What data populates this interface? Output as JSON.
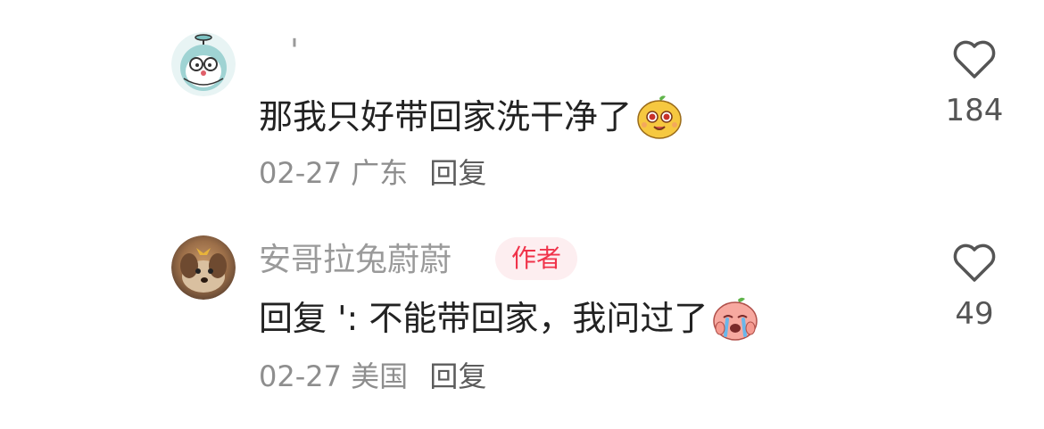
{
  "colors": {
    "username": "#9a9a9a",
    "content": "#222222",
    "meta": "#8e8e8e",
    "reply": "#5c5c5c",
    "badge_bg": "#fdeef0",
    "badge_text": "#f0334a",
    "heart_outline": "#555555"
  },
  "comments": [
    {
      "avatar_icon": "cartoon-cat-avatar",
      "username": "'",
      "content": "那我只好带回家洗干净了",
      "emoji": "mango-smile-emoji",
      "date": "02-27",
      "location": "广东",
      "reply_label": "回复",
      "like_icon": "heart-outline-icon",
      "likes": "184"
    },
    {
      "avatar_icon": "puppy-photo-avatar",
      "username": "安哥拉兔蔚蔚",
      "badge": "作者",
      "content": "回复 ': 不能带回家，我问过了",
      "emoji": "crying-peach-emoji",
      "date": "02-27",
      "location": "美国",
      "reply_label": "回复",
      "like_icon": "heart-outline-icon",
      "likes": "49"
    }
  ]
}
